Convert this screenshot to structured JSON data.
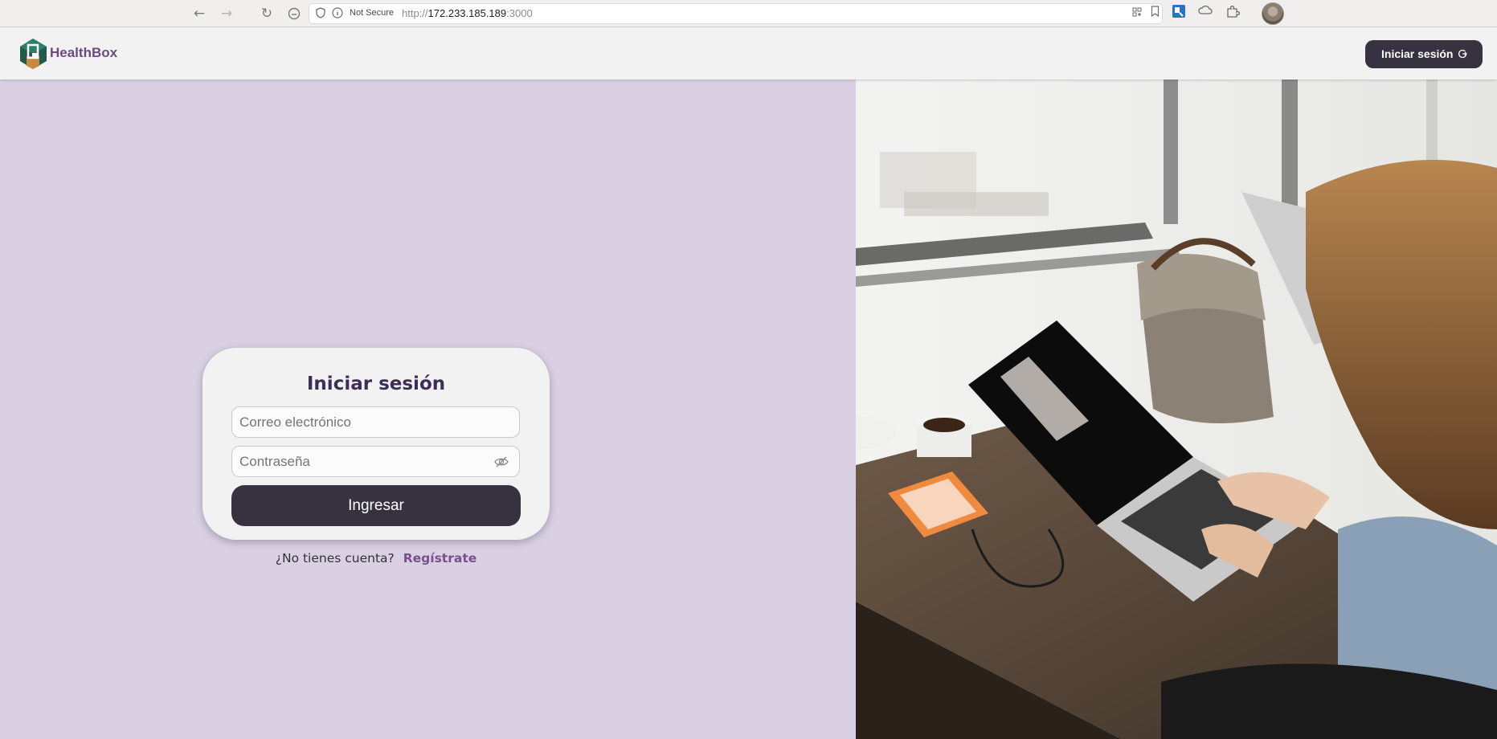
{
  "browser": {
    "security_label": "Not Secure",
    "url_scheme": "http://",
    "url_host": "172.233.185.189",
    "url_port": ":3000"
  },
  "header": {
    "brand": "HealthBox",
    "login_button": "Iniciar sesión"
  },
  "login_form": {
    "title": "Iniciar sesión",
    "email_placeholder": "Correo electrónico",
    "password_placeholder": "Contraseña",
    "submit_label": "Ingresar"
  },
  "signup": {
    "prompt": "¿No tienes cuenta?",
    "link": "Regístrate"
  },
  "colors": {
    "accent": "#6a4a82",
    "dark_button": "#37323f",
    "left_background": "#d9d0e4"
  },
  "icons": [
    "back-icon",
    "forward-icon",
    "reload-icon",
    "home-icon",
    "shield-icon",
    "info-icon",
    "qr-code-icon",
    "bookmark-icon",
    "extension-icon",
    "cloud-icon",
    "puzzle-icon",
    "eye-off-icon",
    "login-icon"
  ]
}
